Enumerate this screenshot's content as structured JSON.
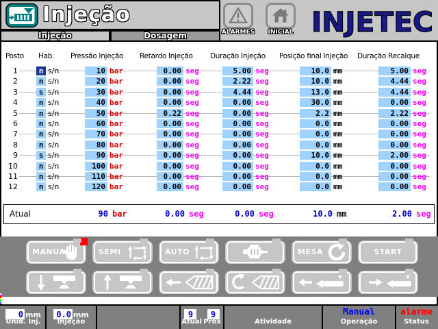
{
  "header": {
    "title": "Injeção",
    "tabs": [
      {
        "label": "Injeção",
        "active": true
      },
      {
        "label": "Dosagem",
        "active": false
      }
    ],
    "nav": [
      {
        "label": "ALARMES",
        "icon": "warning-triangle-icon"
      },
      {
        "label": "INICIAL",
        "icon": "home-icon"
      }
    ],
    "logo_text": "INJETEC"
  },
  "table": {
    "columns": [
      "Posto",
      "Hab.",
      "Pressão Injeção",
      "Retardo Injeção",
      "Duração Injeção",
      "Posição final Injeção",
      "Duração Recalque"
    ],
    "sn_label": "s/n",
    "units": {
      "pressao": "bar",
      "retardo": "seg",
      "duracao": "seg",
      "posicao": "mm",
      "recalque": "seg"
    },
    "rows": [
      {
        "posto": "1",
        "hab": "n",
        "selected": true,
        "pressao": "10",
        "retardo": "0.00",
        "duracao": "5.00",
        "posicao": "10.0",
        "recalque": "5.00"
      },
      {
        "posto": "2",
        "hab": "n",
        "selected": false,
        "pressao": "20",
        "retardo": "0.00",
        "duracao": "2.22",
        "posicao": "10.0",
        "recalque": "4.44"
      },
      {
        "posto": "3",
        "hab": "s",
        "selected": false,
        "pressao": "30",
        "retardo": "0.00",
        "duracao": "4.44",
        "posicao": "13.0",
        "recalque": "4.44"
      },
      {
        "posto": "4",
        "hab": "n",
        "selected": false,
        "pressao": "40",
        "retardo": "0.00",
        "duracao": "0.00",
        "posicao": "30.0",
        "recalque": "0.00"
      },
      {
        "posto": "5",
        "hab": "n",
        "selected": false,
        "pressao": "50",
        "retardo": "0.22",
        "duracao": "0.00",
        "posicao": "2.2",
        "recalque": "2.22"
      },
      {
        "posto": "6",
        "hab": "n",
        "selected": false,
        "pressao": "60",
        "retardo": "0.00",
        "duracao": "0.00",
        "posicao": "0.0",
        "recalque": "0.00"
      },
      {
        "posto": "7",
        "hab": "n",
        "selected": false,
        "pressao": "70",
        "retardo": "0.00",
        "duracao": "0.00",
        "posicao": "0.0",
        "recalque": "0.00"
      },
      {
        "posto": "8",
        "hab": "n",
        "selected": false,
        "pressao": "80",
        "retardo": "0.00",
        "duracao": "0.00",
        "posicao": "0.0",
        "recalque": "0.00"
      },
      {
        "posto": "9",
        "hab": "s",
        "selected": false,
        "pressao": "90",
        "retardo": "0.00",
        "duracao": "0.00",
        "posicao": "10.0",
        "recalque": "2.00"
      },
      {
        "posto": "10",
        "hab": "n",
        "selected": false,
        "pressao": "100",
        "retardo": "0.00",
        "duracao": "0.00",
        "posicao": "0.0",
        "recalque": "0.00"
      },
      {
        "posto": "11",
        "hab": "n",
        "selected": false,
        "pressao": "110",
        "retardo": "0.00",
        "duracao": "0.00",
        "posicao": "0.0",
        "recalque": "0.00"
      },
      {
        "posto": "12",
        "hab": "n",
        "selected": false,
        "pressao": "120",
        "retardo": "0.00",
        "duracao": "0.00",
        "posicao": "0.0",
        "recalque": "0.00"
      }
    ],
    "atual": {
      "label": "Atual",
      "pressao": "90",
      "retardo": "0.00",
      "duracao": "0.00",
      "posicao": "10.0",
      "recalque": "2.00"
    }
  },
  "buttons": {
    "row1": [
      {
        "name": "manual-button",
        "label": "MANUAL",
        "icon": "hand-icon",
        "indicator": true
      },
      {
        "name": "semi-button",
        "label": "SEMI",
        "icon": "semi-cycle-icon",
        "indicator": false
      },
      {
        "name": "auto-button",
        "label": "AUTO",
        "icon": "auto-cycle-icon",
        "indicator": false
      },
      {
        "name": "motor-button",
        "label": "",
        "icon": "motor-icon",
        "indicator": false
      },
      {
        "name": "mesa-button",
        "label": "MESA",
        "icon": "rotate-cw-icon",
        "indicator": false
      },
      {
        "name": "start-button",
        "label": "START",
        "icon": "",
        "indicator": false
      }
    ],
    "row2": [
      {
        "name": "mold-close-button",
        "icon": "arrow-down-mold-icon"
      },
      {
        "name": "mold-open-button",
        "icon": "arrow-up-mold-icon"
      },
      {
        "name": "inject-button",
        "icon": "arrow-left-screw-icon"
      },
      {
        "name": "dosage-button",
        "icon": "rotate-screw-icon"
      },
      {
        "name": "unit-back-button",
        "icon": "arrow-left-unit-icon"
      },
      {
        "name": "unit-forward-button",
        "icon": "arrow-right-unit-icon"
      }
    ]
  },
  "statusbar": {
    "unid_inj": {
      "value": "0",
      "unit": "mm",
      "label": "Unid. Inj."
    },
    "injecao": {
      "value": "0.0",
      "unit": "mm",
      "label": "Injeção"
    },
    "atual_prox": {
      "atual_value": "9",
      "atual_label": "Atual",
      "prox_value": "9",
      "prox_label": "Próx"
    },
    "atividade": {
      "value": "",
      "label": "Atividade"
    },
    "operacao": {
      "value": "Manual",
      "label": "Operação"
    },
    "status": {
      "value": "alarme",
      "label": "Status"
    }
  },
  "colors": {
    "teal": "#008080",
    "logo_navy": "#181888",
    "cell_blue": "#a0d2ff",
    "selected_cell_navy": "#1a3a96",
    "value_blue": "#0000c8",
    "unit_bar_red": "#d40000",
    "unit_seg_magenta": "#ff00ff",
    "status_manual_blue": "#0000ff",
    "status_alarm_red": "#ff0000",
    "panel_gray": "#808080",
    "face_gray": "#c6c6c6",
    "indicator_red": "#ff0000"
  }
}
